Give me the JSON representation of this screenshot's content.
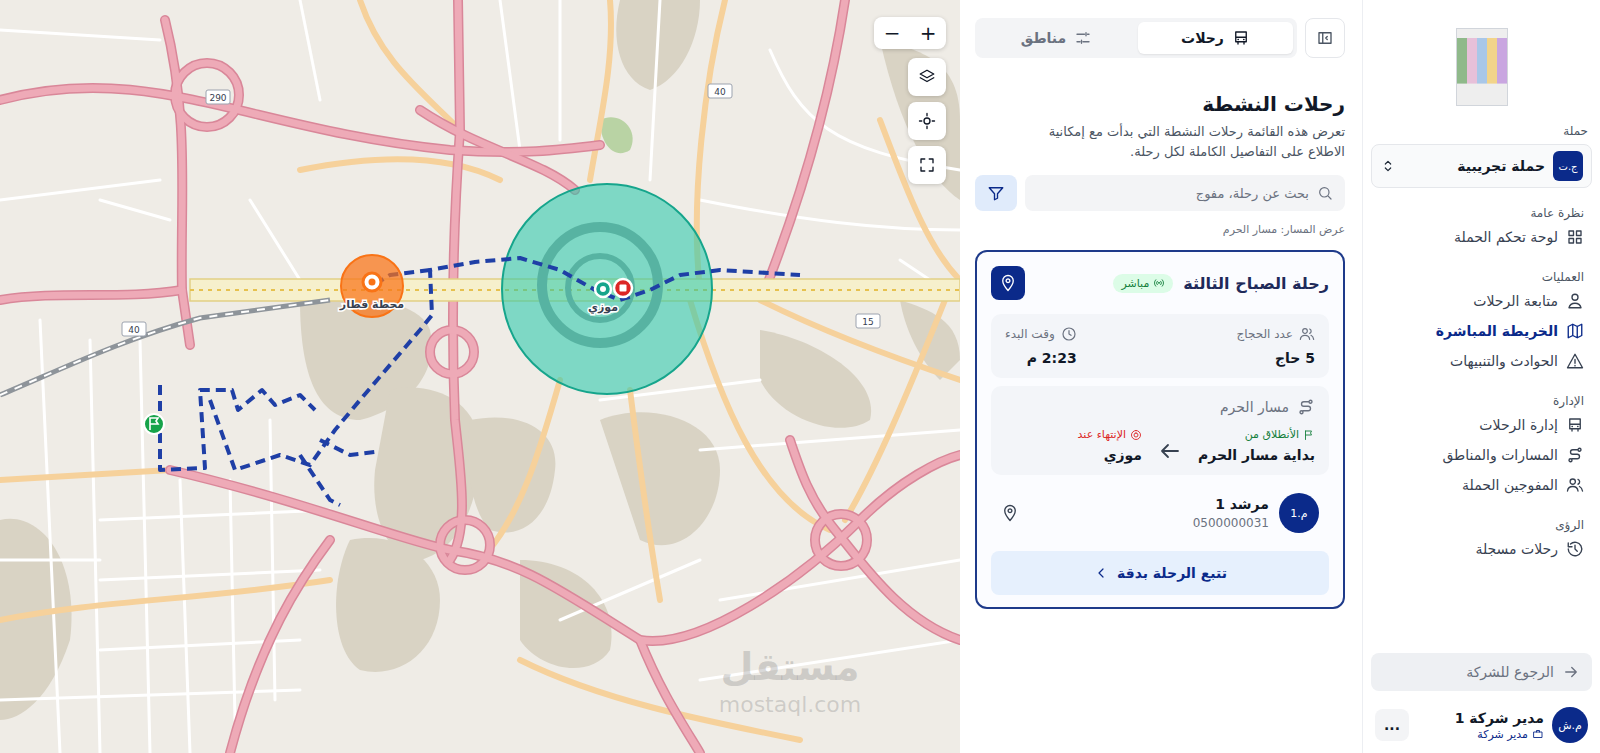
{
  "sidebar": {
    "campaign_label": "حملة",
    "campaign": {
      "initials": "ج.ت",
      "name": "حملة تجريبية"
    },
    "sections": [
      {
        "title": "نظرة عامة",
        "items": [
          {
            "label": "لوحة تحكم الحملة",
            "selected": false
          }
        ]
      },
      {
        "title": "العمليات",
        "items": [
          {
            "label": "متابعة الرحلات",
            "selected": false
          },
          {
            "label": "الخريطة المباشرة",
            "selected": true
          },
          {
            "label": "الحوادث والتنبيهات",
            "selected": false
          }
        ]
      },
      {
        "title": "الإدارة",
        "items": [
          {
            "label": "إدارة الرحلات",
            "selected": false
          },
          {
            "label": "المسارات والمناطق",
            "selected": false
          },
          {
            "label": "المفوجين الحملة",
            "selected": false
          }
        ]
      },
      {
        "title": "الرؤى",
        "items": [
          {
            "label": "رحلات مسجلة",
            "selected": false
          }
        ]
      }
    ],
    "back_button": "الرجوع للشركة",
    "user": {
      "initials": "م.ش",
      "name": "مدير شركة 1",
      "role": "مدير شركة",
      "menu": "..."
    }
  },
  "panel": {
    "tabs": [
      {
        "label": "رحلات",
        "selected": true
      },
      {
        "label": "مناطق",
        "selected": false
      }
    ],
    "title": "رحلات النشطة",
    "description": "تعرض هذه القائمة رحلات النشطة التي بدأت مع إمكانية الاطلاع على التفاصيل الكاملة لكل رحلة.",
    "search": {
      "placeholder": "بحث عن رحلة، مفوج"
    },
    "route_view": "عرض المسار: مسار الحرم",
    "trips": [
      {
        "title": "رحلة الصباح الثالثة",
        "status": "مباشر",
        "live": true,
        "selected": true,
        "pilgrims_label": "عدد الحجاج",
        "pilgrims": "5 حاج",
        "start_label": "وقت البدء",
        "start_time": "2:23 م",
        "route_name": "مسار الحرم",
        "from_label": "الأنطلاق من",
        "from": "بداية مسار الحرم",
        "to_label": "الإنتهاء عند",
        "to": "موزي",
        "guide": {
          "initials": "م.1",
          "name": "مرشد 1",
          "phone": "0500000031"
        },
        "track_button": "تتبع الرحلة بدقة"
      }
    ]
  },
  "map": {
    "zoom_controls": [
      "+",
      "−"
    ],
    "station": {
      "label": "محطة قطار"
    },
    "destination": {
      "label": "موزي"
    },
    "shields": [
      "290",
      "40",
      "40",
      "15"
    ],
    "watermark": {
      "brand": "مستقل",
      "domain": "mostaql.com"
    }
  }
}
